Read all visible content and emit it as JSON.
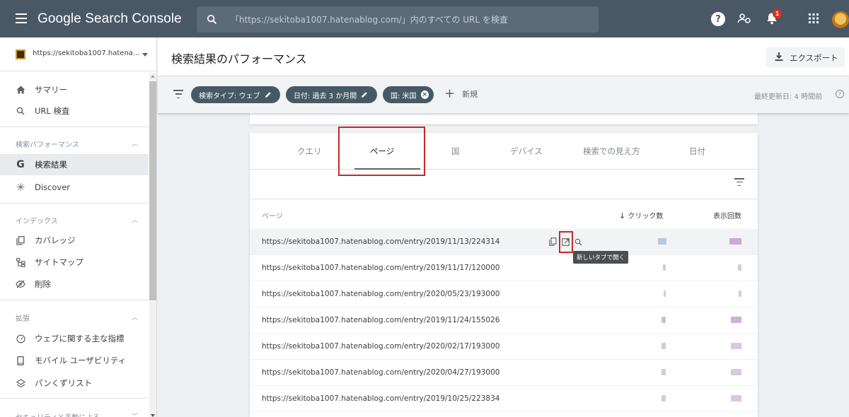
{
  "header": {
    "app_title": "Google Search Console",
    "search_placeholder": "「https://sekitoba1007.hatenablog.com/」内のすべての URL を検査",
    "notification_count": "1",
    "help_label": "?"
  },
  "sidebar": {
    "property_url": "https://sekitoba1007.hatena...",
    "top_items": [
      {
        "label": "サマリー",
        "icon": "home-icon"
      },
      {
        "label": "URL 検査",
        "icon": "search-icon"
      }
    ],
    "sections": [
      {
        "title": "検索パフォーマンス",
        "items": [
          {
            "label": "検索結果",
            "icon": "google-g-icon",
            "active": true
          },
          {
            "label": "Discover",
            "icon": "discover-asterisk-icon"
          }
        ]
      },
      {
        "title": "インデックス",
        "items": [
          {
            "label": "カバレッジ",
            "icon": "coverage-icon"
          },
          {
            "label": "サイトマップ",
            "icon": "sitemap-icon"
          },
          {
            "label": "削除",
            "icon": "removals-icon"
          }
        ]
      },
      {
        "title": "拡張",
        "items": [
          {
            "label": "ウェブに関する主な指標",
            "icon": "gauge-icon"
          },
          {
            "label": "モバイル ユーザビリティ",
            "icon": "smartphone-icon"
          },
          {
            "label": "パンくずリスト",
            "icon": "layers-icon"
          }
        ]
      },
      {
        "title": "セキュリティと手動による"
      }
    ]
  },
  "main": {
    "page_title": "検索結果のパフォーマンス",
    "export_label": "エクスポート",
    "filters": [
      {
        "label": "検索タイプ: ウェブ",
        "action": "edit"
      },
      {
        "label": "日付: 過去 3 か月間",
        "action": "edit"
      },
      {
        "label": "国: 米国",
        "action": "remove"
      }
    ],
    "new_label": "新規",
    "last_updated": "最終更新日: 4 時間前"
  },
  "report": {
    "tabs": [
      "クエリ",
      "ページ",
      "国",
      "デバイス",
      "検索での見え方",
      "日付"
    ],
    "active_tab": 1,
    "columns": {
      "page": "ページ",
      "clicks": "クリック数",
      "impressions": "表示回数"
    },
    "tooltip": "新しいタブで開く",
    "rows": [
      {
        "url": "https://sekitoba1007.hatenablog.com/entry/2019/11/13/224314"
      },
      {
        "url": "https://sekitoba1007.hatenablog.com/entry/2019/11/17/120000"
      },
      {
        "url": "https://sekitoba1007.hatenablog.com/entry/2020/05/23/193000"
      },
      {
        "url": "https://sekitoba1007.hatenablog.com/entry/2019/11/24/155026"
      },
      {
        "url": "https://sekitoba1007.hatenablog.com/entry/2020/02/17/193000"
      },
      {
        "url": "https://sekitoba1007.hatenablog.com/entry/2020/04/27/193000"
      },
      {
        "url": "https://sekitoba1007.hatenablog.com/entry/2019/10/25/223834"
      }
    ]
  },
  "colors": {
    "topbar": "#4a5866",
    "chip": "#455a64",
    "highlight": "#c62828",
    "clicks_blur": "#9fb6d6",
    "impressions_blur": "#c5a3cf"
  }
}
